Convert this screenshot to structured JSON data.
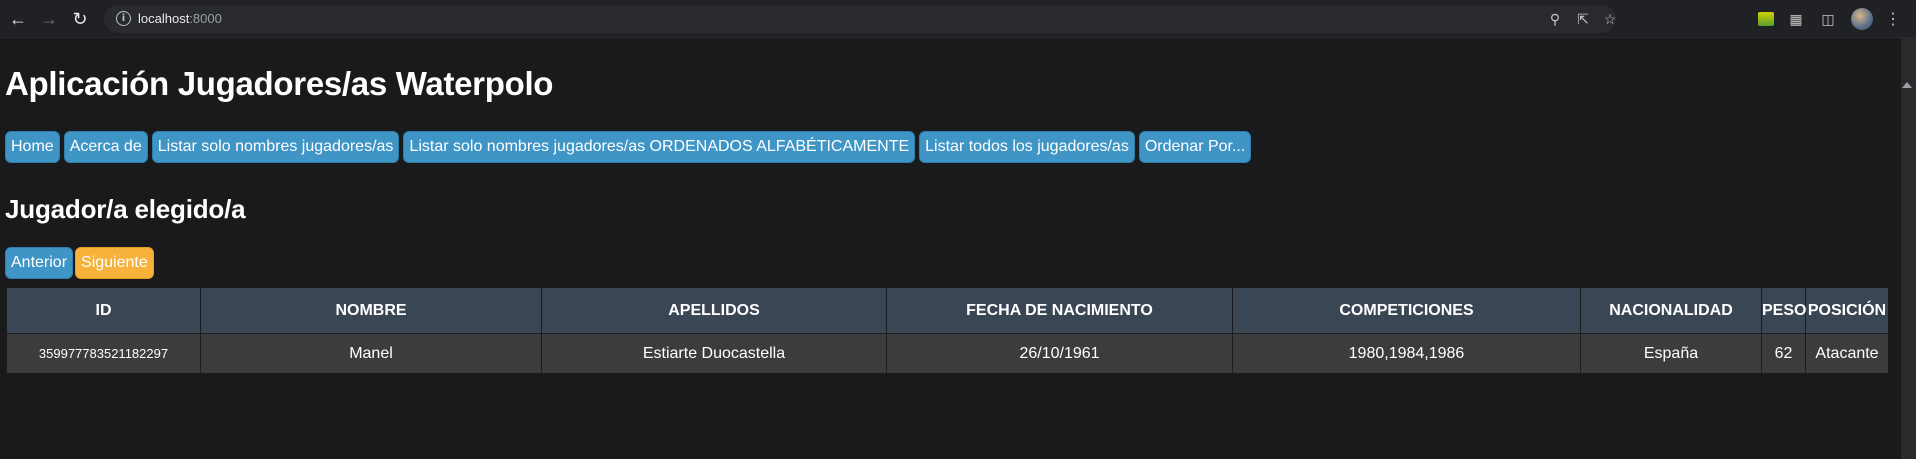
{
  "browser": {
    "url_host": "localhost",
    "url_port": ":8000"
  },
  "page": {
    "title": "Aplicación Jugadores/as Waterpolo",
    "menu": [
      {
        "label": "Home"
      },
      {
        "label": "Acerca de"
      },
      {
        "label": "Listar solo nombres jugadores/as"
      },
      {
        "label": "Listar solo nombres jugadores/as ORDENADOS ALFABÉTICAMENTE"
      },
      {
        "label": "Listar todos los jugadores/as"
      },
      {
        "label": "Ordenar Por..."
      }
    ],
    "subtitle": "Jugador/a elegido/a",
    "pager": {
      "prev": "Anterior",
      "next": "Siguiente"
    },
    "table": {
      "headers": [
        "ID",
        "NOMBRE",
        "APELLIDOS",
        "FECHA DE NACIMIENTO",
        "COMPETICIONES",
        "NACIONALIDAD",
        "PESO",
        "POSICIÓN"
      ],
      "rows": [
        [
          "359977783521182297",
          "Manel",
          "Estiarte Duocastella",
          "26/10/1961",
          "1980,1984,1986",
          "España",
          "62",
          "Atacante"
        ]
      ]
    },
    "colors": {
      "button_blue": "#3e95c6",
      "button_orange": "#f6b23a",
      "table_header": "#3a4654",
      "background": "#1a1a1c"
    }
  }
}
